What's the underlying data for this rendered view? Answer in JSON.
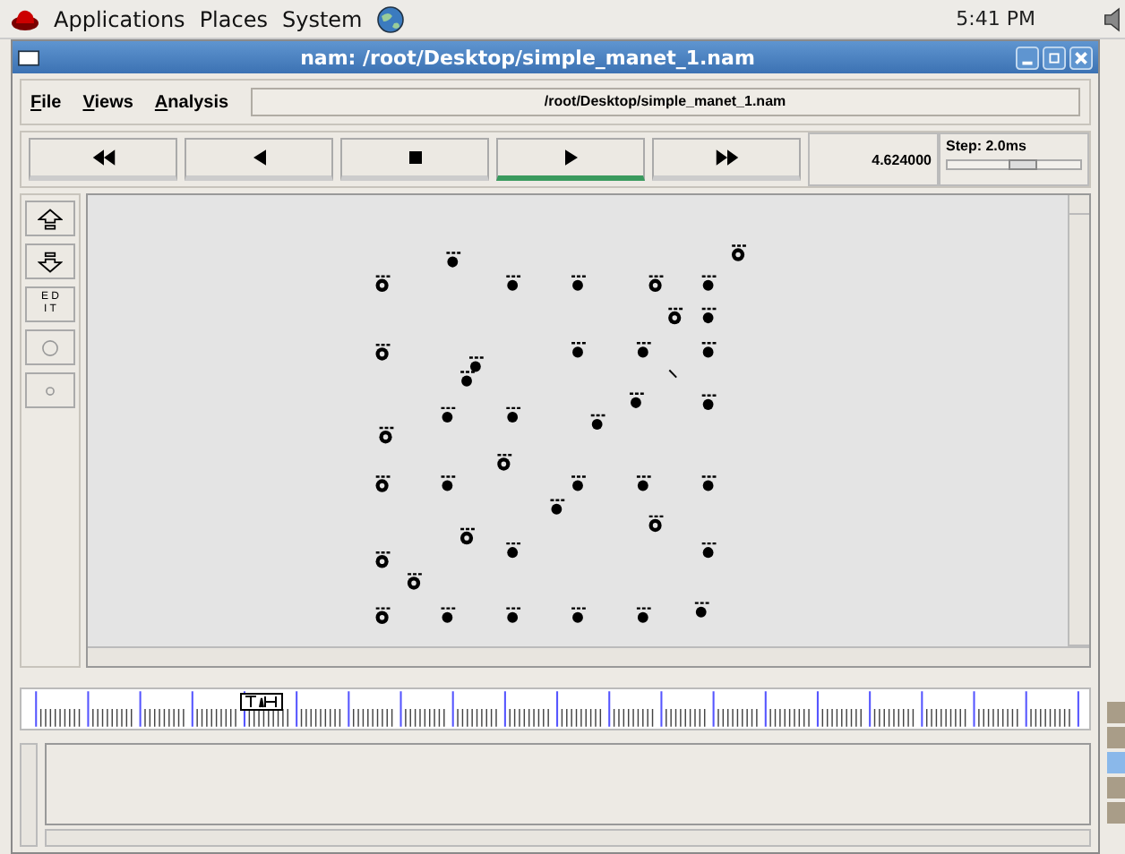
{
  "top_panel": {
    "menus": [
      "Applications",
      "Places",
      "System"
    ],
    "clock": "5:41 PM"
  },
  "window": {
    "title": "nam: /root/Desktop/simple_manet_1.nam"
  },
  "menu_bar": {
    "items": [
      "File",
      "Views",
      "Analysis"
    ],
    "file_path": "/root/Desktop/simple_manet_1.nam"
  },
  "playback": {
    "buttons": [
      {
        "kind": "rewind",
        "selected": false
      },
      {
        "kind": "back",
        "selected": false
      },
      {
        "kind": "stop",
        "selected": false
      },
      {
        "kind": "play",
        "selected": true
      },
      {
        "kind": "forward",
        "selected": false
      }
    ],
    "time": "4.624000",
    "step": "Step: 2.0ms",
    "step_slider": {
      "level": 0.55
    }
  },
  "tools": [
    {
      "kind": "zoom-in"
    },
    {
      "kind": "zoom-out"
    },
    {
      "kind": "edit",
      "label": "E D\nI T"
    },
    {
      "kind": "circle"
    },
    {
      "kind": "small-circle"
    }
  ]
}
